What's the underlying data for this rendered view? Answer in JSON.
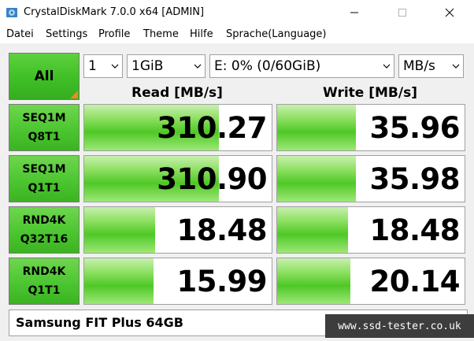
{
  "window": {
    "title": "CrystalDiskMark 7.0.0 x64 [ADMIN]",
    "icon": "disk-icon"
  },
  "menu": [
    {
      "label": "Datei"
    },
    {
      "label": "Settings"
    },
    {
      "label": "Profile"
    },
    {
      "label": "Theme"
    },
    {
      "label": "Hilfe"
    },
    {
      "label": "Sprache(Language)"
    }
  ],
  "controls": {
    "all_label": "All",
    "count": "1",
    "size": "1GiB",
    "drive": "E: 0% (0/60GiB)",
    "unit": "MB/s"
  },
  "headers": {
    "read": "Read [MB/s]",
    "write": "Write [MB/s]"
  },
  "tests": [
    {
      "line1": "SEQ1M",
      "line2": "Q8T1",
      "read": "310.27",
      "write": "35.96",
      "read_fill": 0.72,
      "write_fill": 0.42
    },
    {
      "line1": "SEQ1M",
      "line2": "Q1T1",
      "read": "310.90",
      "write": "35.98",
      "read_fill": 0.72,
      "write_fill": 0.42
    },
    {
      "line1": "RND4K",
      "line2": "Q32T16",
      "read": "18.48",
      "write": "18.48",
      "read_fill": 0.38,
      "write_fill": 0.38
    },
    {
      "line1": "RND4K",
      "line2": "Q1T1",
      "read": "15.99",
      "write": "20.14",
      "read_fill": 0.37,
      "write_fill": 0.39
    }
  ],
  "comment": "Samsung FIT Plus 64GB",
  "watermark": "www.ssd-tester.co.uk",
  "colors": {
    "accent_green": "#49c42e",
    "corner_orange": "#f08a1d"
  }
}
